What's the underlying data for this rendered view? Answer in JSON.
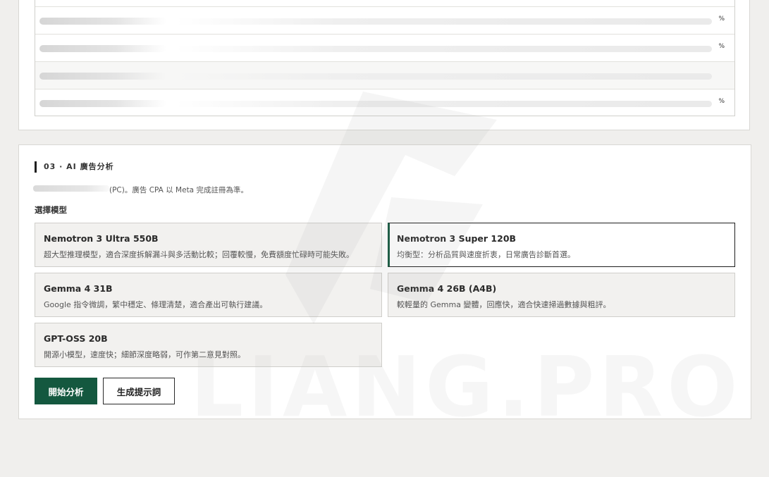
{
  "table": {
    "rows": [
      {
        "percent": "%"
      },
      {
        "percent": "%"
      },
      {
        "percent": ""
      },
      {
        "percent": "%"
      }
    ]
  },
  "section": {
    "title": "03 · AI 廣告分析",
    "note": "(PC)。廣告 CPA 以 Meta 完成註冊為準。",
    "model_label": "選擇模型"
  },
  "models": [
    {
      "name": "Nemotron 3 Ultra 550B",
      "desc": "超大型推理模型，適合深度拆解漏斗與多活動比較；回覆較慢，免費額度忙碌時可能失敗。",
      "selected": false
    },
    {
      "name": "Nemotron 3 Super 120B",
      "desc": "均衡型：分析品質與速度折衷，日常廣告診斷首選。",
      "selected": true
    },
    {
      "name": "Gemma 4 31B",
      "desc": "Google 指令微調，繁中穩定、條理清楚，適合產出可執行建議。",
      "selected": false
    },
    {
      "name": "Gemma 4 26B (A4B)",
      "desc": "較輕量的 Gemma 變體，回應快，適合快速掃過數據與粗評。",
      "selected": false
    },
    {
      "name": "GPT-OSS 20B",
      "desc": "開源小模型，速度快；細節深度略弱，可作第二意見對照。",
      "selected": false
    }
  ],
  "buttons": {
    "analyze": "開始分析",
    "generate_prompt": "生成提示詞"
  },
  "watermark": "LIANG.PRO",
  "colors": {
    "accent": "#14583f",
    "background": "#f0efed"
  }
}
